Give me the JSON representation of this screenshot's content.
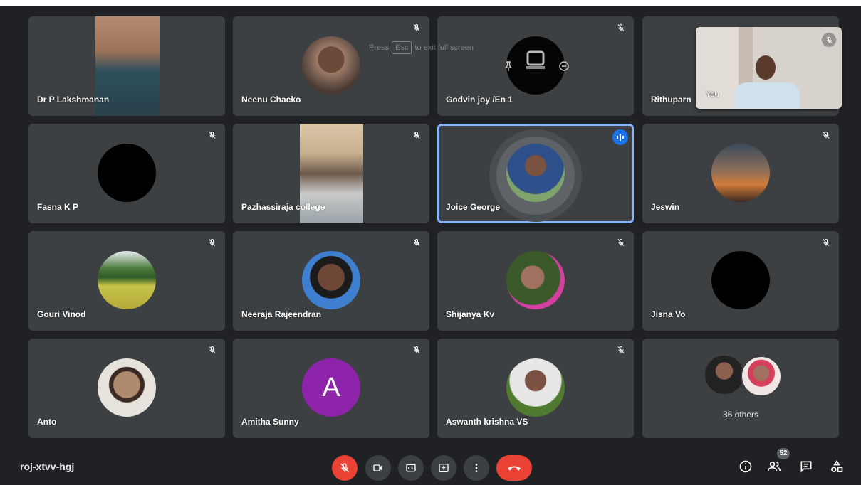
{
  "meeting": {
    "code": "roj-xtvv-hgj",
    "participants_count": "52"
  },
  "fullscreen_hint": {
    "press": "Press",
    "key": "Esc",
    "rest": "to exit full screen"
  },
  "self_view": {
    "label": "You"
  },
  "tiles": [
    {
      "name": "Dr P Lakshmanan"
    },
    {
      "name": "Neenu Chacko"
    },
    {
      "name": "Godvin joy /En 1"
    },
    {
      "name": "Rithuparn"
    },
    {
      "name": "Fasna K P"
    },
    {
      "name": "Pazhassiraja college"
    },
    {
      "name": "Joice George"
    },
    {
      "name": "Jeswin"
    },
    {
      "name": "Gouri Vinod"
    },
    {
      "name": "Neeraja Rajeendran"
    },
    {
      "name": "Shijanya Kv"
    },
    {
      "name": "Jisna Vo"
    },
    {
      "name": "Anto"
    },
    {
      "name": "Amitha Sunny",
      "initial": "A"
    },
    {
      "name": "Aswanth krishna VS"
    },
    {
      "name": "36 others"
    }
  ],
  "colors": {
    "background": "#202124",
    "tile": "#3c4043",
    "danger": "#ea4335",
    "speaking": "#8ab4f8"
  },
  "controls": [
    "mic-off-icon",
    "camera-icon",
    "captions-icon",
    "present-icon",
    "more-icon",
    "end-call-icon"
  ],
  "right_controls": [
    "info-icon",
    "people-icon",
    "chat-icon",
    "activities-icon"
  ]
}
